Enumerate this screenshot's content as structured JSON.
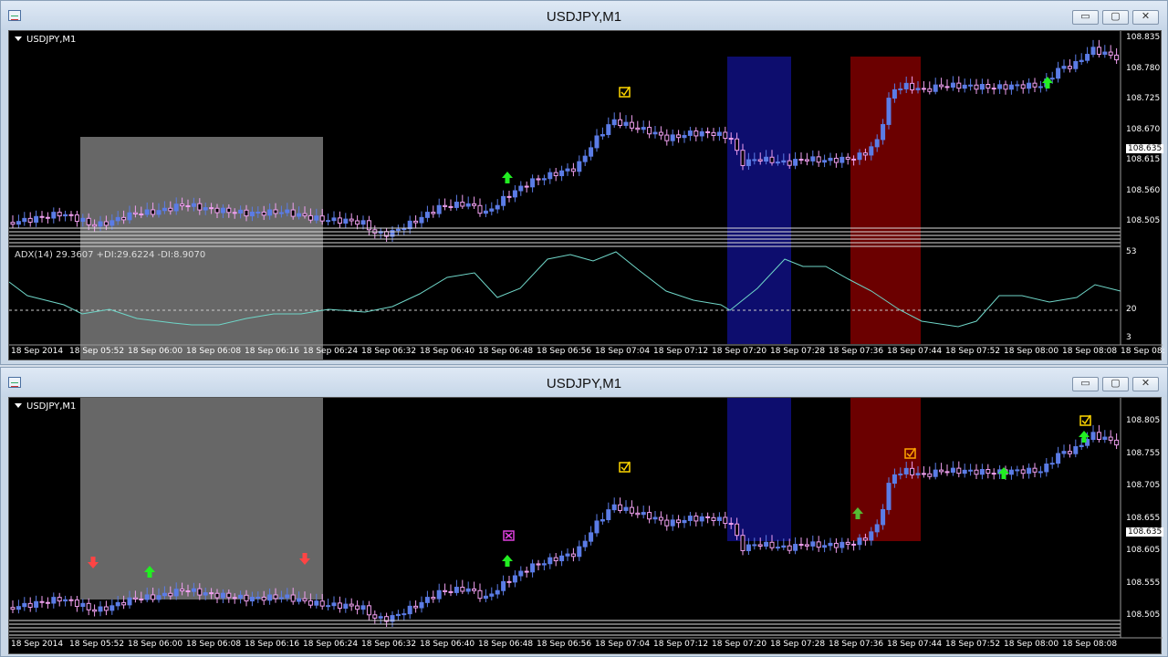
{
  "windows": [
    {
      "title": "USDJPY,M1",
      "symbol_label": "USDJPY,M1",
      "indicator_label": "ADX(14) 29.3607 +DI:29.6224 -DI:8.9070",
      "current_price": "108.635",
      "price_ticks": [
        "108.835",
        "108.780",
        "108.725",
        "108.670",
        "108.615",
        "108.560",
        "108.505"
      ],
      "indicator_ticks": [
        "53",
        "20",
        "3"
      ],
      "time_ticks": [
        "18 Sep 2014",
        "18 Sep 05:52",
        "18 Sep 06:00",
        "18 Sep 06:08",
        "18 Sep 06:16",
        "18 Sep 06:24",
        "18 Sep 06:32",
        "18 Sep 06:40",
        "18 Sep 06:48",
        "18 Sep 06:56",
        "18 Sep 07:04",
        "18 Sep 07:12",
        "18 Sep 07:20",
        "18 Sep 07:28",
        "18 Sep 07:36",
        "18 Sep 07:44",
        "18 Sep 07:52",
        "18 Sep 08:00",
        "18 Sep 08:08",
        "18 Sep 08:"
      ]
    },
    {
      "title": "USDJPY,M1",
      "symbol_label": "USDJPY,M1",
      "current_price": "108.635",
      "price_ticks": [
        "108.805",
        "108.755",
        "108.705",
        "108.655",
        "108.605",
        "108.555",
        "108.505"
      ],
      "time_ticks": [
        "18 Sep 2014",
        "18 Sep 05:52",
        "18 Sep 06:00",
        "18 Sep 06:08",
        "18 Sep 06:16",
        "18 Sep 06:24",
        "18 Sep 06:32",
        "18 Sep 06:40",
        "18 Sep 06:48",
        "18 Sep 06:56",
        "18 Sep 07:04",
        "18 Sep 07:12",
        "18 Sep 07:20",
        "18 Sep 07:28",
        "18 Sep 07:36",
        "18 Sep 07:44",
        "18 Sep 07:52",
        "18 Sep 08:00",
        "18 Sep 08:08"
      ]
    }
  ],
  "window_buttons": {
    "minimize": "▭",
    "maximize": "▢",
    "close": "✕"
  },
  "colors": {
    "background": "#000000",
    "candle_up": "#5b7ce6",
    "candle_down": "#f0a0f0",
    "adx_line": "#6fd6c8",
    "gray_zone": "#8a8a8a",
    "blue_zone": "#0d0d6e",
    "red_zone": "#6b0000",
    "arrow_up": "#22ee22",
    "arrow_down": "#ff4444",
    "check_yellow": "#ffd700",
    "check_orange": "#ffa500",
    "x_magenta": "#e040e0"
  },
  "icons": [
    "app-icon",
    "dropdown-triangle-icon",
    "minimize-icon",
    "maximize-icon",
    "close-icon",
    "buy-arrow-icon",
    "sell-arrow-icon",
    "check-mark-icon",
    "x-mark-icon"
  ]
}
